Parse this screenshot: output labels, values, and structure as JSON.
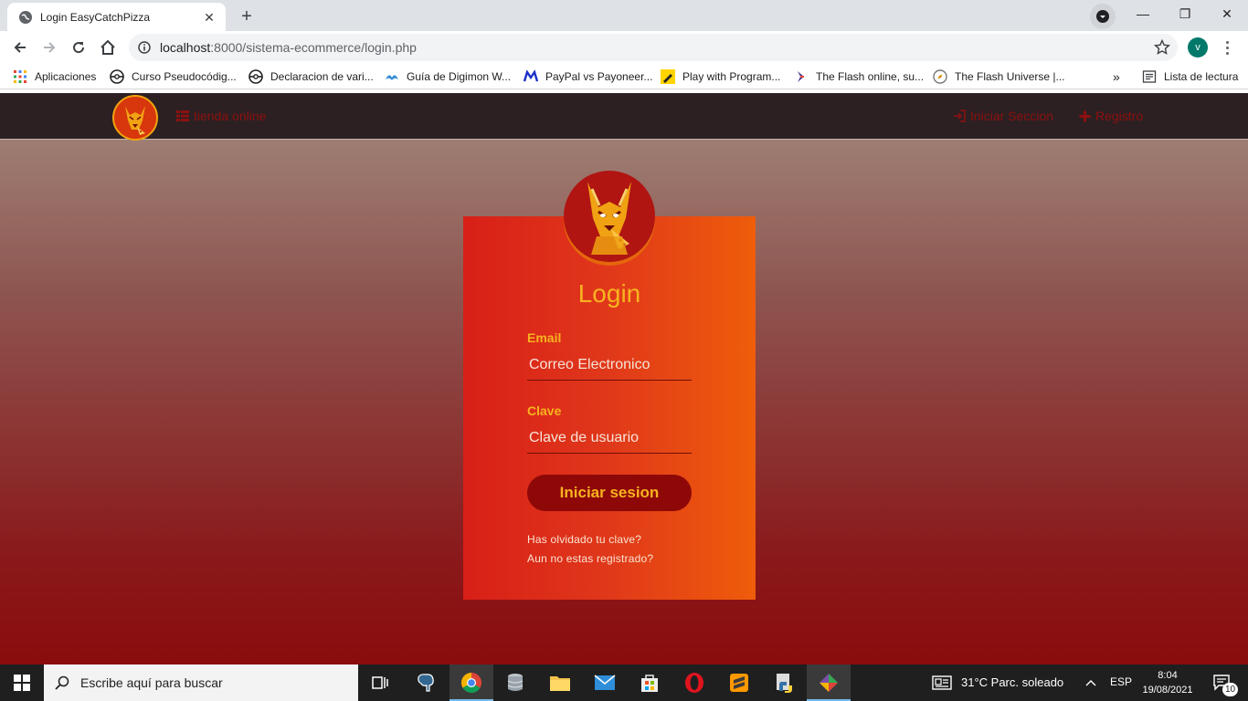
{
  "browser": {
    "tab_title": "Login EasyCatchPizza",
    "url_host": "localhost",
    "url_path": ":8000/sistema-ecommerce/login.php",
    "avatar_letter": "v"
  },
  "bookmarks": [
    {
      "label": "Aplicaciones",
      "icon": "apps-grid-icon"
    },
    {
      "label": "Curso Pseudocódig...",
      "icon": "pokeball-icon"
    },
    {
      "label": "Declaracion de vari...",
      "icon": "pokeball-icon"
    },
    {
      "label": "Guía de Digimon W...",
      "icon": "wing-icon"
    },
    {
      "label": "PayPal vs Payoneer...",
      "icon": "m-logo-icon"
    },
    {
      "label": "Play with Program...",
      "icon": "pencil-icon"
    },
    {
      "label": "The Flash online, su...",
      "icon": "chevron-logo-icon"
    },
    {
      "label": "The Flash Universe |...",
      "icon": "compass-icon"
    }
  ],
  "bookmarks_overflow": "»",
  "reading_list": "Lista de lectura",
  "site": {
    "brand_link": "tienda online",
    "login_link": "Iniciar Seccion",
    "register_link": "Registro"
  },
  "login": {
    "title": "Login",
    "email_label": "Email",
    "email_placeholder": "Correo Electronico",
    "password_label": "Clave",
    "password_placeholder": "Clave de usuario",
    "submit": "Iniciar sesion",
    "forgot": "Has olvidado tu clave?",
    "register": "Aun no estas registrado?"
  },
  "taskbar": {
    "search_placeholder": "Escribe aquí para buscar",
    "weather": "31°C  Parc. soleado",
    "language": "ESP",
    "time": "8:04",
    "date": "19/08/2021",
    "notifications": "10"
  },
  "colors": {
    "accent": "#f8b320",
    "card_left": "#d81f18",
    "card_right": "#ef5d0a",
    "nav_bg": "#2c2022"
  }
}
